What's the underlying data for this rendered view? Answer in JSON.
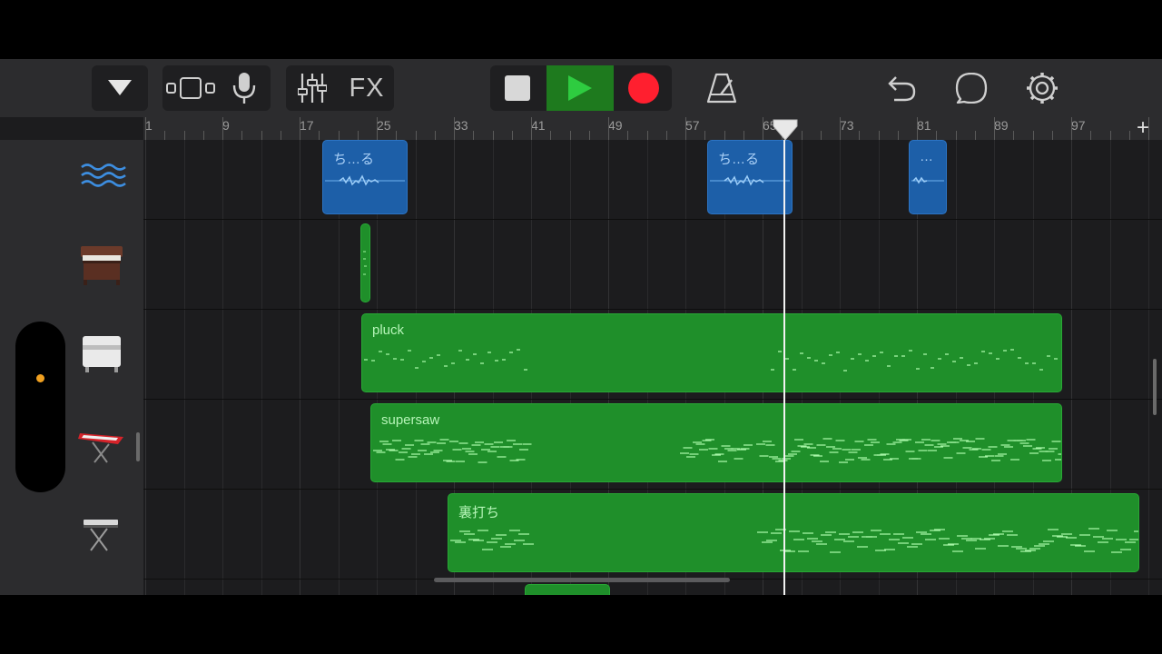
{
  "toolbar": {
    "tracks_view_icon": "track-view-icon",
    "browser_icon": "dropdown-triangle-icon",
    "mic_icon": "microphone-icon",
    "mixer_icon": "mixer-sliders-icon",
    "fx_label": "FX",
    "stop_icon": "stop-icon",
    "play_icon": "play-icon",
    "record_icon": "record-icon",
    "metronome_icon": "metronome-icon",
    "undo_icon": "undo-icon",
    "loop_icon": "loop-icon",
    "settings_icon": "gear-icon",
    "colors": {
      "play": "#2ecc40",
      "record": "#ff1f2f"
    }
  },
  "ruler": {
    "bars": [
      "1",
      "9",
      "17",
      "25",
      "33",
      "41",
      "49",
      "57",
      "65",
      "73",
      "81",
      "89",
      "97"
    ],
    "add_label": "+"
  },
  "tracks": [
    {
      "icon": "audio-waves-icon",
      "regions": [
        {
          "name": "ち…る",
          "type": "audio"
        },
        {
          "name": "ち…る",
          "type": "audio"
        },
        {
          "name": "…",
          "type": "audio"
        }
      ]
    },
    {
      "icon": "organ-icon",
      "regions": [
        {
          "name": "",
          "type": "midi"
        }
      ]
    },
    {
      "icon": "electric-piano-icon",
      "regions": [
        {
          "name": "pluck",
          "type": "midi"
        }
      ]
    },
    {
      "icon": "red-synth-keyboard-icon",
      "regions": [
        {
          "name": "supersaw",
          "type": "midi"
        }
      ]
    },
    {
      "icon": "keyboard-stand-icon",
      "regions": [
        {
          "name": "裏打ち",
          "type": "midi"
        }
      ]
    }
  ],
  "colors": {
    "audio_region": "#1d5fa8",
    "midi_region": "#1f8f2a",
    "slider_dot": "#f0a020"
  }
}
